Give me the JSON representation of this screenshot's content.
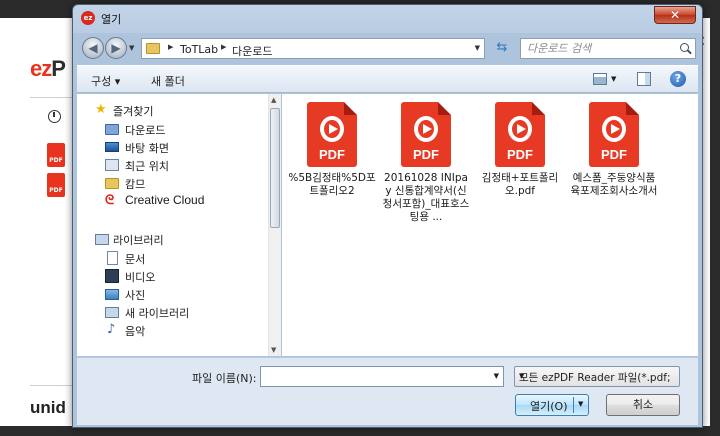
{
  "background_app": {
    "logo_red": "ez",
    "logo_rest": "P",
    "pdf_badge": "PDF",
    "brand": "unid",
    "close_glyph": "✕"
  },
  "dialog": {
    "title": "열기",
    "close_glyph": "✕",
    "address": {
      "crumbs": [
        "ToTLab",
        "다운로드"
      ]
    },
    "search": {
      "placeholder": "다운로드 검색"
    },
    "toolbar": {
      "organize_label": "구성 ▾",
      "new_folder_label": "새 폴더",
      "help_glyph": "?"
    },
    "nav": {
      "favorites": "즐겨찾기",
      "items": [
        "다운로드",
        "바탕 화면",
        "최근 위치",
        "캄므",
        "Creative Cloud"
      ],
      "libraries": "라이브러리",
      "library_items": [
        "문서",
        "비디오",
        "사진",
        "새 라이브러리",
        "음악"
      ]
    },
    "files": [
      {
        "name": "%5B김정태%5D포트폴리오2",
        "icon": "pdf-file-icon"
      },
      {
        "name": "20161028 INIpay 신통합계약서(신청서포함)_대표호스팅용 ...",
        "icon": "pdf-file-icon"
      },
      {
        "name": "김정태+포트폴리오.pdf",
        "icon": "pdf-file-icon"
      },
      {
        "name": "예스폼_주둥양식품육포제조회사소개서",
        "icon": "pdf-file-icon"
      }
    ],
    "pdf_icon_text": "PDF",
    "bottom": {
      "filename_label": "파일 이름(N):",
      "filename_value": "",
      "filter_value": "모든 ezPDF Reader 파일(*.pdf;",
      "open_label": "열기(O)",
      "cancel_label": "취소"
    }
  }
}
